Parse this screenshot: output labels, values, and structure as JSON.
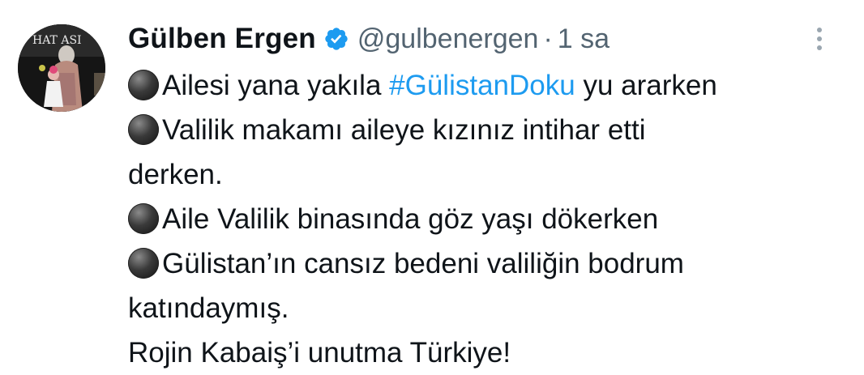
{
  "author": {
    "display_name": "Gülben Ergen",
    "handle": "@gulbenergen",
    "separator": "·",
    "time": "1 sa",
    "verified": true,
    "verified_color": "#1d9bf0",
    "avatar_banner_text": "HAT ASI"
  },
  "more_menu_icon": "more-vertical-icon",
  "tweet": {
    "lines": [
      {
        "bullet": "black-circle-emoji",
        "pre": "Ailesi yana yakıla ",
        "hashtag": "#GülistanDoku",
        "post": " yu ararken"
      },
      {
        "bullet": "black-circle-emoji",
        "text": "Valilik makamı aileye kızınız intihar etti"
      },
      {
        "text": "derken."
      },
      {
        "bullet": "black-circle-emoji",
        "text": "Aile Valilik binasında göz yaşı dökerken"
      },
      {
        "bullet": "black-circle-emoji",
        "text": "Gülistan’ın cansız bedeni valiliğin bodrum"
      },
      {
        "text": "katındaymış."
      },
      {
        "text": "Rojin Kabaiş’i unutma Türkiye!"
      }
    ]
  },
  "colors": {
    "text": "#0f1419",
    "secondary": "#536471",
    "link": "#1d9bf0"
  }
}
